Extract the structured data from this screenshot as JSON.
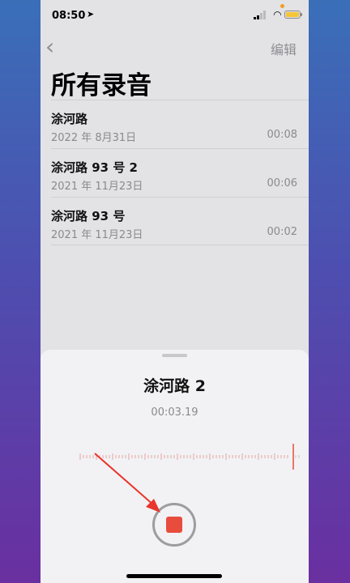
{
  "status": {
    "time": "08:50"
  },
  "nav": {
    "back_icon": "chevron-left-icon",
    "edit_label": "编辑"
  },
  "page": {
    "title": "所有录音"
  },
  "recordings": [
    {
      "name": "涂河路",
      "date": "2022 年 8月31日",
      "duration": "00:08"
    },
    {
      "name": "涂河路 93 号 2",
      "date": "2021 年 11月23日",
      "duration": "00:06"
    },
    {
      "name": "涂河路 93 号",
      "date": "2021 年 11月23日",
      "duration": "00:02"
    }
  ],
  "current": {
    "name": "涂河路 2",
    "elapsed": "00:03.19"
  },
  "colors": {
    "record_red": "#e84c3d",
    "annotation_arrow": "#e8362c",
    "battery": "#f5c53a"
  }
}
